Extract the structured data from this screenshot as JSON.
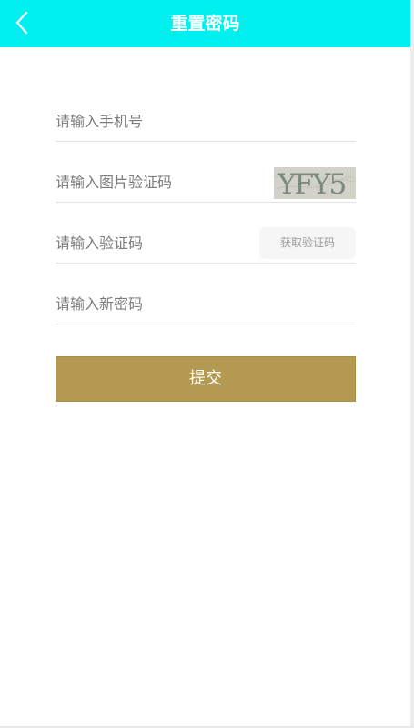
{
  "header": {
    "title": "重置密码",
    "background_color": "#00f0ef"
  },
  "form": {
    "phone": {
      "placeholder": "请输入手机号",
      "value": ""
    },
    "image_code": {
      "placeholder": "请输入图片验证码",
      "value": ""
    },
    "captcha_image": {
      "text": "YFY5"
    },
    "sms_code": {
      "placeholder": "请输入验证码",
      "value": "",
      "button_label": "获取验证码"
    },
    "new_password": {
      "placeholder": "请输入新密码",
      "value": ""
    },
    "submit_label": "提交",
    "submit_color": "#b49950"
  }
}
